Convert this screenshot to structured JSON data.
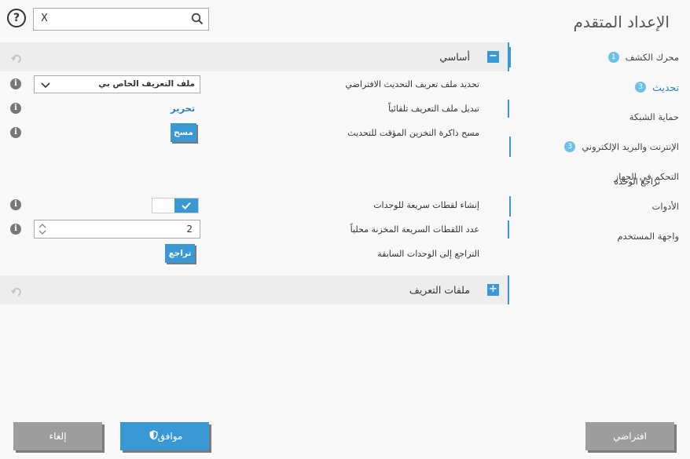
{
  "page": {
    "title": "الإعداد المتقدم"
  },
  "search": {
    "clear_label": "X",
    "value": "",
    "placeholder": ""
  },
  "help": {
    "label": "?"
  },
  "sidebar": {
    "items": [
      {
        "label": "محرك الكشف",
        "badge": "1"
      },
      {
        "label": "تحديث",
        "badge": "3",
        "active": true
      },
      {
        "label": "حماية الشبكة"
      },
      {
        "label": "الإنترنت والبريد الإلكتروني",
        "badge": "3"
      },
      {
        "label": "التحكم في الجهاز"
      },
      {
        "label": "الأدوات"
      },
      {
        "label": "واجهة المستخدم"
      }
    ]
  },
  "main": {
    "basic": {
      "title": "أساسي",
      "toggle": "−",
      "default_profile": {
        "label": "تحديد ملف تعريف التحديث الافتراضي",
        "value": "ملف التعريف الخاص بي"
      },
      "auto_switch": {
        "label": "تبديل ملف التعريف تلقائياً",
        "link": "تحرير"
      },
      "clear_cache": {
        "label": "مسح ذاكرة التخزين المؤقت للتحديث",
        "button": "مسح"
      },
      "rollback": {
        "title": "تراجع الوحدة",
        "snapshots": {
          "label": "إنشاء لقطات سريعة للوحدات",
          "enabled": true
        },
        "local_count": {
          "label": "عدد اللقطات السريعة المخزنة محلياً",
          "value": "2"
        },
        "revert": {
          "label": "التراجع إلى الوحدات السابقة",
          "button": "تراجع"
        }
      }
    },
    "profiles": {
      "title": "ملفات التعريف",
      "toggle": "+"
    }
  },
  "footer": {
    "default_label": "افتراضي",
    "ok_label": "موافق",
    "cancel_label": "إلغاء"
  },
  "colors": {
    "accent": "#3a98d4",
    "badge": "#6ec0ea",
    "link": "#2a7fc4",
    "button_gray": "#9d9d9d"
  },
  "icons": {
    "help": "question-circle-icon",
    "search": "magnifier-icon",
    "reset": "undo-arrow-icon",
    "info": "info-circle-icon",
    "ok": "shield-icon"
  }
}
